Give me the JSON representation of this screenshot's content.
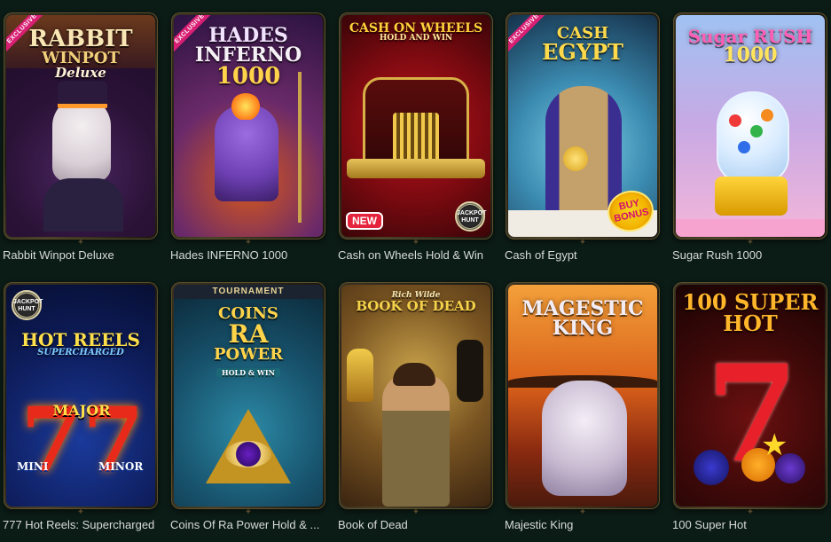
{
  "games": [
    {
      "label": "Rabbit Winpot Deluxe",
      "title_lines": [
        "RABBIT",
        "WINPOT",
        "Deluxe"
      ],
      "badge": "EXCLUSIVE"
    },
    {
      "label": "Hades INFERNO 1000",
      "title_lines": [
        "HADES",
        "INFERNO",
        "1000"
      ],
      "badge": "EXCLUSIVE"
    },
    {
      "label": "Cash on Wheels Hold & Win",
      "title_lines": [
        "CASH ON WHEELS",
        "HOLD AND WIN"
      ],
      "badge": "NEW",
      "badge2": [
        "JACKPOT",
        "HUNT"
      ]
    },
    {
      "label": "Cash of Egypt",
      "title_lines": [
        "CASH",
        "EGYPT"
      ],
      "badge": "EXCLUSIVE",
      "badge2": [
        "BUY",
        "BONUS"
      ]
    },
    {
      "label": "Sugar Rush 1000",
      "title_lines": [
        "Sugar RUSH",
        "1000"
      ]
    },
    {
      "label": "777 Hot Reels: Supercharged",
      "title_lines": [
        "HOT REELS",
        "SUPERCHARGED",
        "MAJOR",
        "MINI",
        "MINOR"
      ],
      "badge": [
        "JACKPOT",
        "HUNT"
      ]
    },
    {
      "label": "Coins Of Ra Power Hold & ...",
      "title_lines": [
        "TOURNAMENT",
        "COINS",
        "RA",
        "POWER",
        "HOLD & WIN"
      ]
    },
    {
      "label": "Book of Dead",
      "title_lines": [
        "Rich Wilde",
        "BOOK OF DEAD"
      ]
    },
    {
      "label": "Majestic King",
      "title_lines": [
        "MAGESTIC",
        "KING"
      ]
    },
    {
      "label": "100 Super Hot",
      "title_lines": [
        "100 SUPER",
        "HOT"
      ]
    }
  ],
  "colors": {
    "background": "#0b1b15",
    "label_text": "#d7dbd9",
    "frame_gold": "#5c4f2c"
  }
}
